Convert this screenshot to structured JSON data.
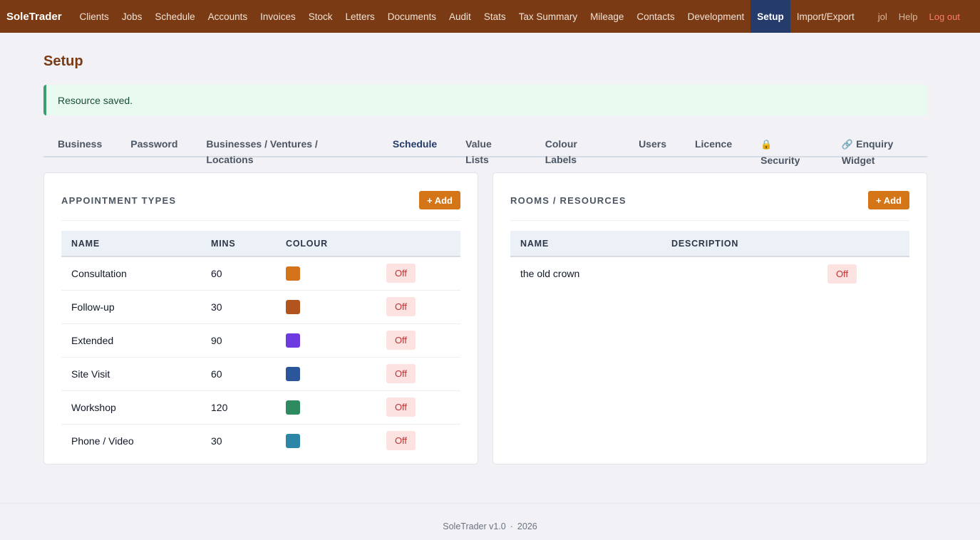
{
  "nav": {
    "brand": "SoleTrader",
    "items": [
      "Clients",
      "Jobs",
      "Schedule",
      "Accounts",
      "Invoices",
      "Stock",
      "Letters",
      "Documents",
      "Audit",
      "Stats",
      "Tax Summary",
      "Mileage",
      "Contacts",
      "Development",
      "Setup",
      "Import/Export"
    ],
    "active": "Setup",
    "user": "jol",
    "help": "Help",
    "logout": "Log out"
  },
  "page": {
    "title": "Setup"
  },
  "alert": {
    "message": "Resource saved."
  },
  "tabs": [
    {
      "label": "Business",
      "icon": "",
      "active": false
    },
    {
      "label": "Password",
      "icon": "",
      "active": false
    },
    {
      "label": "Businesses / Ventures / Locations",
      "icon": "",
      "active": false
    },
    {
      "label": "Schedule",
      "icon": "",
      "active": true
    },
    {
      "label": "Value Lists",
      "icon": "",
      "active": false
    },
    {
      "label": "Colour Labels",
      "icon": "",
      "active": false
    },
    {
      "label": "Users",
      "icon": "",
      "active": false
    },
    {
      "label": "Licence",
      "icon": "",
      "active": false
    },
    {
      "label": "Security",
      "icon": "lock-icon",
      "active": false
    },
    {
      "label": "Enquiry Widget",
      "icon": "link-icon",
      "active": false
    }
  ],
  "appointment_types": {
    "title": "APPOINTMENT TYPES",
    "add_label": "+ Add",
    "columns": [
      "NAME",
      "MINS",
      "COLOUR",
      ""
    ],
    "rows": [
      {
        "name": "Consultation",
        "mins": "60",
        "colour": "#d4731a",
        "toggle": "Off"
      },
      {
        "name": "Follow-up",
        "mins": "30",
        "colour": "#b3541e",
        "toggle": "Off"
      },
      {
        "name": "Extended",
        "mins": "90",
        "colour": "#6d3be0",
        "toggle": "Off"
      },
      {
        "name": "Site Visit",
        "mins": "60",
        "colour": "#2b579a",
        "toggle": "Off"
      },
      {
        "name": "Workshop",
        "mins": "120",
        "colour": "#2e8b60",
        "toggle": "Off"
      },
      {
        "name": "Phone / Video",
        "mins": "30",
        "colour": "#2d86a8",
        "toggle": "Off"
      }
    ]
  },
  "resources": {
    "title": "ROOMS / RESOURCES",
    "add_label": "+ Add",
    "columns": [
      "NAME",
      "DESCRIPTION",
      ""
    ],
    "rows": [
      {
        "name": "the old crown",
        "description": "",
        "toggle": "Off"
      }
    ]
  },
  "footer": {
    "product": "SoleTrader v1.0",
    "separator": "·",
    "year": "2026"
  },
  "colors": {
    "nav_bg": "#7a3a14",
    "active_nav": "#243b6b",
    "accent": "#d47518",
    "success": "#3e9f6e"
  }
}
